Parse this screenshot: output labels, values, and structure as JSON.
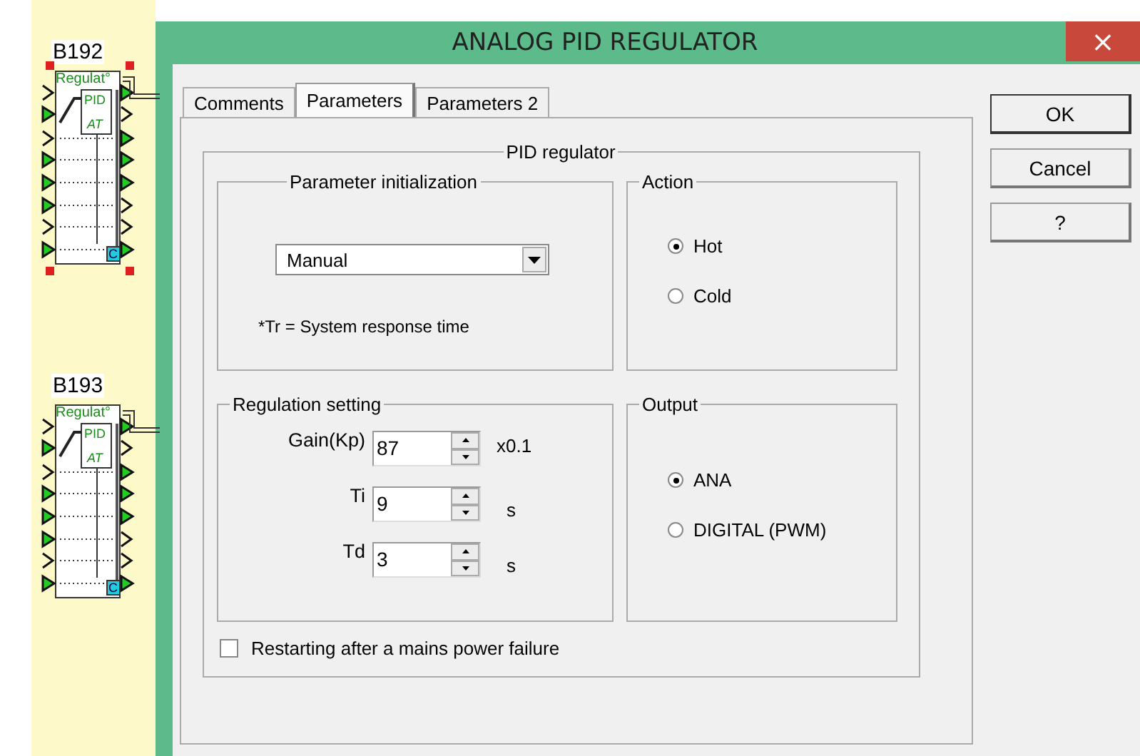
{
  "canvas": {
    "blocks": [
      {
        "label": "B192",
        "title": "Regulat°",
        "pid": "PID",
        "at": "AT",
        "corner": "C",
        "selected": true
      },
      {
        "label": "B193",
        "title": "Regulat°",
        "pid": "PID",
        "at": "AT",
        "corner": "C",
        "selected": false
      }
    ]
  },
  "window": {
    "title": "ANALOG PID REGULATOR",
    "close": "×"
  },
  "tabs": [
    {
      "label": "Comments",
      "selected": false
    },
    {
      "label": "Parameters",
      "selected": true
    },
    {
      "label": "Parameters 2",
      "selected": false
    }
  ],
  "pid_regulator": {
    "title": "PID regulator",
    "parameter_initialization": {
      "title": "Parameter initialization",
      "dropdown": "Manual",
      "note": "*Tr = System response time"
    },
    "action": {
      "title": "Action",
      "options": [
        {
          "label": "Hot",
          "selected": true
        },
        {
          "label": "Cold",
          "selected": false
        }
      ]
    },
    "regulation_setting": {
      "title": "Regulation setting",
      "fields": [
        {
          "label": "Gain(Kp)",
          "value": "87",
          "unit": "x0.1"
        },
        {
          "label": "Ti",
          "value": "9",
          "unit": "s"
        },
        {
          "label": "Td",
          "value": "3",
          "unit": "s"
        }
      ]
    },
    "output": {
      "title": "Output",
      "options": [
        {
          "label": "ANA",
          "selected": true
        },
        {
          "label": "DIGITAL (PWM)",
          "selected": false
        }
      ]
    },
    "restart_checkbox": {
      "label": "Restarting after a mains power failure",
      "checked": false
    }
  },
  "buttons": [
    "OK",
    "Cancel",
    "?"
  ]
}
